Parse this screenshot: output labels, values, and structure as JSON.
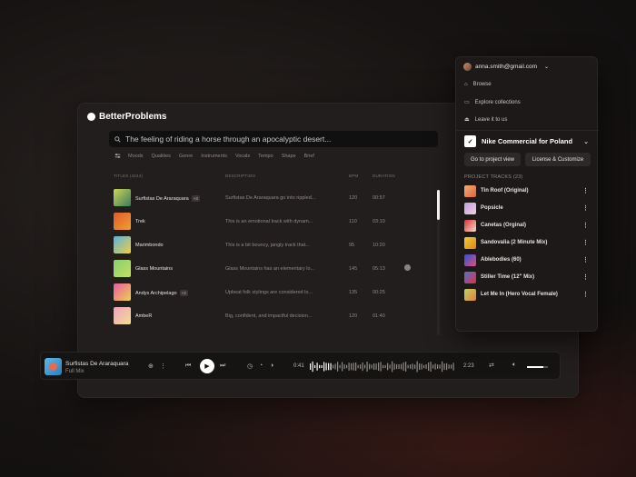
{
  "app": {
    "logo": "BetterProblems"
  },
  "search": {
    "placeholder": "The feeling of riding a horse through an apocalyptic desert..."
  },
  "filters": [
    "Moods",
    "Qualities",
    "Genre",
    "Instruments",
    "Vocals",
    "Tempo",
    "Shape",
    "Brief"
  ],
  "table": {
    "headers": {
      "titles": "TITLES (4244)",
      "description": "DESCRIPTION",
      "bpm": "BPM",
      "duration": "DURATION"
    },
    "rows": [
      {
        "title": "Surfistas De Araraquara",
        "badge": "+3",
        "desc": "Surfistas De Araraquara go into rippled...",
        "bpm": "120",
        "dur": "00:57",
        "colors": [
          "#c9d85a",
          "#3a7a5a"
        ]
      },
      {
        "title": "Trek",
        "badge": "",
        "desc": "This is an emotional track with dynam...",
        "bpm": "110",
        "dur": "03:10",
        "colors": [
          "#e05a2a",
          "#f0a030"
        ]
      },
      {
        "title": "Marimbondo",
        "badge": "",
        "desc": "This is a bit bouncy, jangly track that...",
        "bpm": "95",
        "dur": "10:20",
        "colors": [
          "#5ab0e0",
          "#f0d040"
        ]
      },
      {
        "title": "Glass Mountains",
        "badge": "",
        "desc": "Glass Mountains has an elementary lo...",
        "bpm": "145",
        "dur": "05:13",
        "colors": [
          "#8ad070",
          "#c0e060"
        ]
      },
      {
        "title": "Andys Archipelago",
        "badge": "+2",
        "desc": "Upbeat folk stylings are considered lo...",
        "bpm": "135",
        "dur": "00:25",
        "colors": [
          "#e85aa0",
          "#f0d050"
        ]
      },
      {
        "title": "AmbeR",
        "badge": "",
        "desc": "Big, confident, and impactful decision...",
        "bpm": "120",
        "dur": "01:40",
        "colors": [
          "#f0a0c0",
          "#f0e090"
        ]
      }
    ]
  },
  "player": {
    "title": "Surfistas De Araraquara",
    "subtitle": "Full Mix",
    "elapsed": "0:41",
    "total": "2:23",
    "volume": 0.8
  },
  "dropdown": {
    "email": "anna.smith@gmail.com",
    "menu": [
      "Browse",
      "Explore collections",
      "Leave it to us"
    ],
    "project": "Nike Commercial for Poland",
    "buttons": {
      "view": "Go to project view",
      "license": "License & Customize"
    },
    "tracks_label": "PROJECT TRACKS (23)",
    "tracks": [
      {
        "name": "Tin Roof (Original)",
        "colors": [
          "#f0b070",
          "#e06040"
        ]
      },
      {
        "name": "Popsicle",
        "colors": [
          "#c0a0e0",
          "#f0d0e0"
        ]
      },
      {
        "name": "Canetas (Orginal)",
        "colors": [
          "#e03030",
          "#f0e0d0"
        ]
      },
      {
        "name": "Sandovalia (2 Minute Mix)",
        "colors": [
          "#f0d030",
          "#e08020"
        ]
      },
      {
        "name": "Ablebodies (60)",
        "colors": [
          "#3050d0",
          "#e05080"
        ]
      },
      {
        "name": "Stiller Time (12\" Mix)",
        "colors": [
          "#5070d0",
          "#e03040"
        ]
      },
      {
        "name": "Let Me In (Hero Vocal Female)",
        "colors": [
          "#c0d060",
          "#e08040"
        ]
      }
    ]
  }
}
